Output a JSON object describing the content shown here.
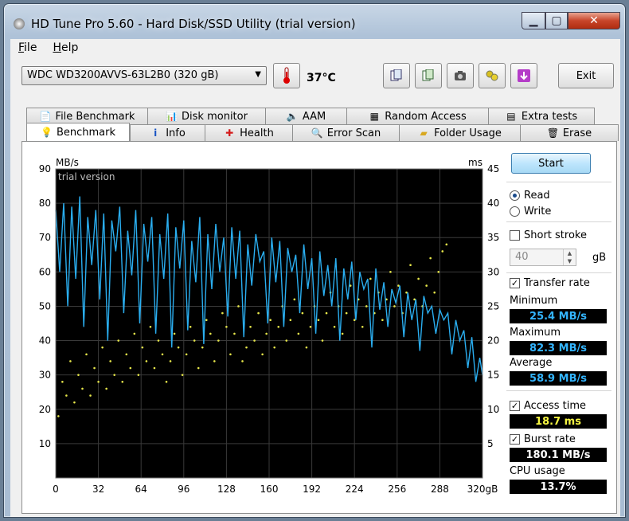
{
  "window": {
    "title": "HD Tune Pro 5.60 - Hard Disk/SSD Utility (trial version)"
  },
  "menu": {
    "file": "File",
    "help": "Help"
  },
  "toolbar": {
    "drive": "WDC WD3200AVVS-63L2B0 (320 gB)",
    "temperature": "37°C",
    "exit": "Exit",
    "icons": [
      "copy-text-icon",
      "copy-screen-icon",
      "camera-icon",
      "options-icon",
      "save-icon"
    ]
  },
  "tabs": {
    "row1": [
      "File Benchmark",
      "Disk monitor",
      "AAM",
      "Random Access",
      "Extra tests"
    ],
    "row2": [
      "Benchmark",
      "Info",
      "Health",
      "Error Scan",
      "Folder Usage",
      "Erase"
    ],
    "active": "Benchmark"
  },
  "controls": {
    "start": "Start",
    "read": "Read",
    "write": "Write",
    "mode_selected": "read",
    "short_stroke": "Short stroke",
    "short_stroke_checked": false,
    "short_stroke_value": "40",
    "short_stroke_unit": "gB",
    "transfer_rate": "Transfer rate",
    "transfer_rate_checked": true,
    "access_time": "Access time",
    "access_time_checked": true,
    "burst_rate": "Burst rate",
    "burst_rate_checked": true
  },
  "stats": {
    "minimum_label": "Minimum",
    "minimum": "25.4 MB/s",
    "maximum_label": "Maximum",
    "maximum": "82.3 MB/s",
    "average_label": "Average",
    "average": "58.9 MB/s",
    "access_time": "18.7 ms",
    "burst_rate": "180.1 MB/s",
    "cpu_label": "CPU usage",
    "cpu": "13.7%"
  },
  "colors": {
    "transfer_line": "#2aaef0",
    "access_points": "#e6e64a",
    "plot_bg": "#000000",
    "access_value": "#f5f542",
    "transfer_value": "#33b5ff",
    "burst_value": "#ffffff"
  },
  "chart_data": {
    "type": "line",
    "watermark": "trial version",
    "xlabel": "",
    "ylabel_left": "MB/s",
    "ylabel_right": "ms",
    "x_ticks": [
      "0",
      "32",
      "64",
      "96",
      "128",
      "160",
      "192",
      "224",
      "256",
      "288",
      "320gB"
    ],
    "y_left_ticks": [
      10,
      20,
      30,
      40,
      50,
      60,
      70,
      80,
      90
    ],
    "y_right_ticks": [
      5,
      10,
      15,
      20,
      25,
      30,
      35,
      40,
      45
    ],
    "xlim": [
      0,
      320
    ],
    "ylim_left": [
      0,
      90
    ],
    "ylim_right": [
      0,
      45
    ],
    "grid": true,
    "series": [
      {
        "axis": "left",
        "color": "#2aaef0",
        "x": [
          0,
          3,
          6,
          9,
          12,
          15,
          18,
          21,
          24,
          27,
          30,
          33,
          36,
          39,
          42,
          45,
          48,
          51,
          54,
          57,
          60,
          63,
          66,
          69,
          72,
          75,
          78,
          81,
          84,
          87,
          90,
          93,
          96,
          99,
          102,
          105,
          108,
          111,
          114,
          117,
          120,
          123,
          126,
          129,
          132,
          135,
          138,
          141,
          144,
          147,
          150,
          153,
          156,
          159,
          162,
          165,
          168,
          171,
          174,
          177,
          180,
          183,
          186,
          189,
          192,
          195,
          198,
          201,
          204,
          207,
          210,
          213,
          216,
          219,
          222,
          225,
          228,
          231,
          234,
          237,
          240,
          243,
          246,
          249,
          252,
          255,
          258,
          261,
          264,
          267,
          270,
          273,
          276,
          279,
          282,
          285,
          288,
          291,
          294,
          297,
          300,
          303,
          306,
          309,
          312,
          315,
          318,
          320
        ],
        "y": [
          78,
          60,
          80,
          50,
          79,
          58,
          82,
          44,
          76,
          62,
          78,
          52,
          77,
          40,
          75,
          66,
          79,
          48,
          72,
          59,
          78,
          45,
          74,
          63,
          76,
          42,
          71,
          58,
          77,
          38,
          73,
          61,
          75,
          43,
          69,
          57,
          76,
          39,
          71,
          55,
          74,
          60,
          70,
          47,
          73,
          58,
          72,
          41,
          68,
          56,
          71,
          63,
          66,
          45,
          70,
          57,
          69,
          44,
          67,
          60,
          65,
          48,
          68,
          55,
          64,
          42,
          66,
          53,
          62,
          50,
          64,
          40,
          61,
          52,
          63,
          46,
          60,
          55,
          58,
          38,
          61,
          49,
          57,
          44,
          55,
          51,
          56,
          41,
          54,
          46,
          52,
          37,
          53,
          48,
          50,
          42,
          49,
          46,
          48,
          36,
          46,
          40,
          43,
          32,
          41,
          28,
          35,
          30
        ]
      },
      {
        "axis": "right",
        "type": "scatter",
        "color": "#e6e64a",
        "x": [
          2,
          5,
          8,
          11,
          14,
          17,
          20,
          23,
          26,
          29,
          32,
          35,
          38,
          41,
          44,
          47,
          50,
          53,
          56,
          59,
          62,
          65,
          68,
          71,
          74,
          77,
          80,
          83,
          86,
          89,
          92,
          95,
          98,
          101,
          104,
          107,
          110,
          113,
          116,
          119,
          122,
          125,
          128,
          131,
          134,
          137,
          140,
          143,
          146,
          149,
          152,
          155,
          158,
          161,
          164,
          167,
          170,
          173,
          176,
          179,
          182,
          185,
          188,
          191,
          194,
          197,
          200,
          203,
          206,
          209,
          212,
          215,
          218,
          221,
          224,
          227,
          230,
          233,
          236,
          239,
          242,
          245,
          248,
          251,
          254,
          257,
          260,
          263,
          266,
          269,
          272,
          275,
          278,
          281,
          284,
          287,
          290,
          293
        ],
        "y": [
          9,
          14,
          12,
          17,
          11,
          15,
          13,
          18,
          12,
          16,
          14,
          19,
          13,
          17,
          15,
          20,
          14,
          18,
          16,
          21,
          15,
          19,
          17,
          22,
          16,
          20,
          18,
          14,
          17,
          21,
          19,
          15,
          18,
          22,
          20,
          16,
          19,
          23,
          21,
          17,
          20,
          24,
          22,
          18,
          21,
          25,
          17,
          19,
          22,
          20,
          24,
          18,
          21,
          23,
          19,
          22,
          25,
          20,
          23,
          26,
          21,
          24,
          19,
          22,
          25,
          23,
          20,
          24,
          27,
          22,
          25,
          21,
          24,
          28,
          23,
          26,
          22,
          25,
          29,
          24,
          27,
          23,
          26,
          30,
          25,
          28,
          24,
          27,
          31,
          26,
          29,
          25,
          28,
          32,
          27,
          30,
          33,
          34
        ]
      }
    ]
  }
}
